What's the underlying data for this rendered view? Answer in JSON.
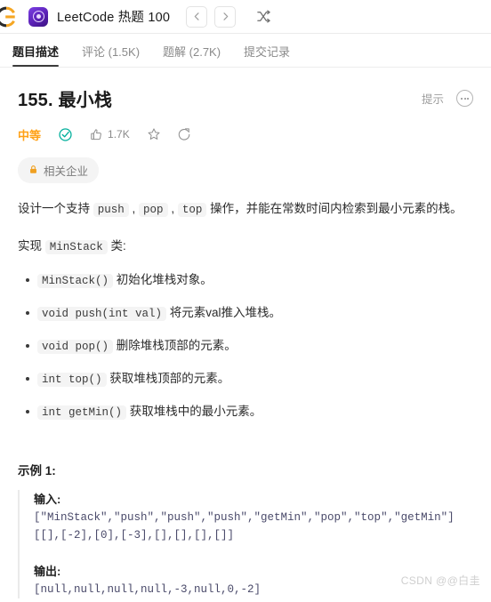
{
  "topbar": {
    "browser_logo": "chrome-logo",
    "app_icon": "leetcode-app-icon",
    "app_title": "LeetCode 热题 100",
    "prev_label": "‹",
    "next_label": "›",
    "shuffle_icon": "shuffle-icon"
  },
  "tabs": [
    {
      "label": "题目描述",
      "active": true
    },
    {
      "label": "评论 (1.5K)",
      "active": false
    },
    {
      "label": "题解 (2.7K)",
      "active": false
    },
    {
      "label": "提交记录",
      "active": false
    }
  ],
  "problem": {
    "title": "155. 最小栈",
    "hint_label": "提示",
    "more_icon": "ellipsis-circle-icon",
    "difficulty": "中等",
    "difficulty_color": "#ffa116",
    "solved_icon": "check-circle-icon",
    "solved_color": "#00af9b",
    "like_icon": "thumbs-up-icon",
    "like_count": "1.7K",
    "star_icon": "star-icon",
    "share_icon": "share-icon",
    "company_tag": {
      "icon": "lock-icon",
      "label": "相关企业"
    }
  },
  "description": {
    "intro_1": "设计一个支持 ",
    "code_push": "push",
    "sep_1": " , ",
    "code_pop": "pop",
    "sep_2": " , ",
    "code_top": "top",
    "intro_2": " 操作，并能在常数时间内检索到最小元素的栈。",
    "implement_prefix": "实现 ",
    "implement_code": "MinStack",
    "implement_suffix": " 类:"
  },
  "api_list": [
    {
      "code": "MinStack()",
      "text": " 初始化堆栈对象。"
    },
    {
      "code": "void push(int val)",
      "text": " 将元素val推入堆栈。"
    },
    {
      "code": "void pop()",
      "text": " 删除堆栈顶部的元素。"
    },
    {
      "code": "int top()",
      "text": " 获取堆栈顶部的元素。"
    },
    {
      "code": "int getMin()",
      "text": " 获取堆栈中的最小元素。"
    }
  ],
  "example": {
    "heading": "示例 1:",
    "input_label": "输入:",
    "input_code": "[\"MinStack\",\"push\",\"push\",\"push\",\"getMin\",\"pop\",\"top\",\"getMin\"]\n[[],[-2],[0],[-3],[],[],[],[]]",
    "output_label": "输出:",
    "output_code": "[null,null,null,null,-3,null,0,-2]"
  },
  "watermark": "CSDN @@白圭"
}
